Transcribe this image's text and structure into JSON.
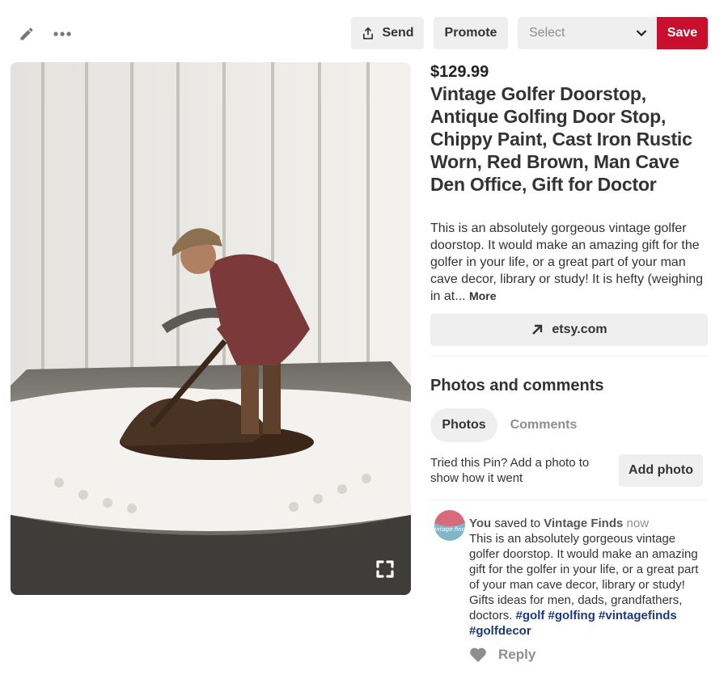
{
  "toolbar": {
    "edit_icon": "pencil-icon",
    "more_icon": "more-dots-icon",
    "send_label": "Send",
    "promote_label": "Promote",
    "board_select": {
      "placeholder": "Select"
    },
    "save_label": "Save",
    "save_color": "#c8102e"
  },
  "pin": {
    "price": "$129.99",
    "title": "Vintage Golfer Doorstop, Antique Golfing Door Stop, Chippy Paint, Cast Iron Rustic Worn, Red Brown, Man Cave Den Office, Gift for Doctor",
    "description": "This is an absolutely gorgeous vintage golfer doorstop. It would make an amazing gift for the golfer in your life, or a great part of your man cave decor, library or study! It is hefty (weighing in at...",
    "more_label": "More",
    "link_label": "etsy.com"
  },
  "photos_comments": {
    "heading": "Photos and comments",
    "tabs": [
      {
        "label": "Photos",
        "active": true
      },
      {
        "label": "Comments",
        "active": false
      }
    ],
    "tried_text": "Tried this Pin? Add a photo to show how it went",
    "add_photo_label": "Add photo"
  },
  "comment": {
    "user": "You",
    "saved_to": "saved to",
    "board": "Vintage Finds",
    "time": "now",
    "body": "This is an absolutely gorgeous vintage golfer doorstop. It would make an amazing gift for the golfer in your life, or a great part of your man cave decor, library or study! Gifts ideas for men, dads, grandfathers, doctors.",
    "hashtags": [
      "#golf",
      "#golfing",
      "#vintagefinds",
      "#golfdecor"
    ],
    "reply_label": "Reply",
    "avatar_text": "vintage finds"
  }
}
